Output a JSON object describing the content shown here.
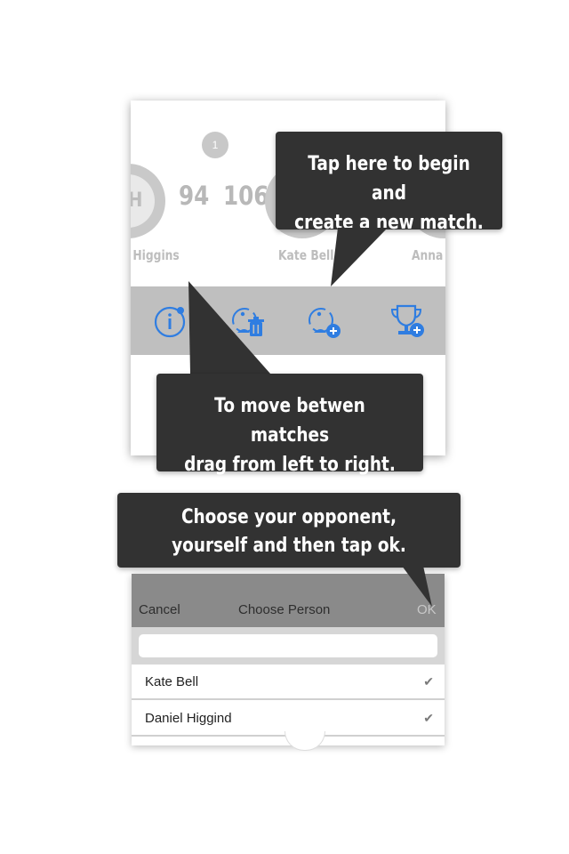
{
  "match": {
    "round": "1",
    "players": [
      {
        "initials": "DH",
        "name": "Daniel Higgins",
        "score": "94"
      },
      {
        "initials": "",
        "name": "Kate Bell",
        "score": "106"
      },
      {
        "initials": "",
        "name": "Anna Haro",
        "score": ""
      }
    ]
  },
  "toolbar": {
    "icons": [
      "info-icon",
      "delete-match-icon",
      "new-match-icon",
      "new-tournament-icon"
    ]
  },
  "tips": {
    "new_match": "Tap here to begin and\ncreate a new match.",
    "move_matches": "To move betwen matches\ndrag from left to right.",
    "choose_person": "Choose your opponent,\nyourself and then tap ok."
  },
  "sheet": {
    "cancel_label": "Cancel",
    "title": "Choose Person",
    "ok_label": "OK",
    "search_value": "",
    "people": [
      {
        "name": "Kate Bell",
        "check": "✔"
      },
      {
        "name": "Daniel Higgind",
        "check": "✔"
      }
    ]
  },
  "colors": {
    "accent": "#2f7de1",
    "toolbar_bg": "#bfbfbf",
    "tooltip_bg": "#323232",
    "sheet_header_bg": "#8a8a8a"
  }
}
